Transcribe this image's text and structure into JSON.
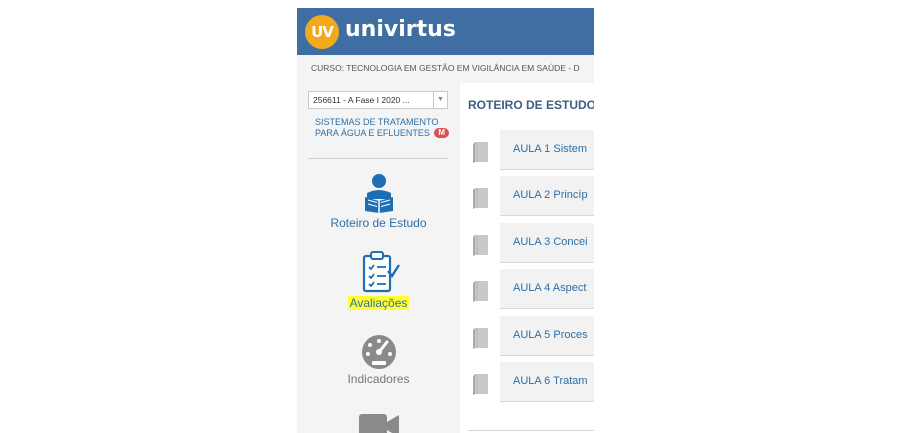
{
  "header": {
    "logo_text": "UV",
    "brand": "univirtus"
  },
  "course_bar": {
    "text": "CURSO: TECNOLOGIA EM GESTÃO EM VIGILÂNCIA EM SAÚDE - D"
  },
  "sidebar": {
    "select_value": "256611 - A Fase I 2020 ...",
    "discipline_name": "SISTEMAS DE TRATAMENTO PARA ÁGUA E EFLUENTES",
    "discipline_badge": "M",
    "items": [
      {
        "label": "Roteiro de Estudo",
        "icon": "study-guide-icon"
      },
      {
        "label": "Avaliações",
        "icon": "clipboard-icon"
      },
      {
        "label": "Indicadores",
        "icon": "gauge-icon"
      },
      {
        "label": "",
        "icon": "video-camera-icon"
      }
    ]
  },
  "main": {
    "title": "ROTEIRO DE ESTUDO",
    "lessons": [
      {
        "label": "AULA 1   Sistem"
      },
      {
        "label": "AULA 2   Princíp"
      },
      {
        "label": "AULA 3   Concei"
      },
      {
        "label": "AULA 4   Aspect"
      },
      {
        "label": "AULA 5   Proces"
      },
      {
        "label": "AULA 6   Tratam"
      }
    ]
  },
  "colors": {
    "header_bg": "#3f6fa2",
    "logo_bg": "#f3a91c",
    "link_blue": "#2e6fa7",
    "highlight": "#ffff33",
    "badge_red": "#d9534f"
  }
}
